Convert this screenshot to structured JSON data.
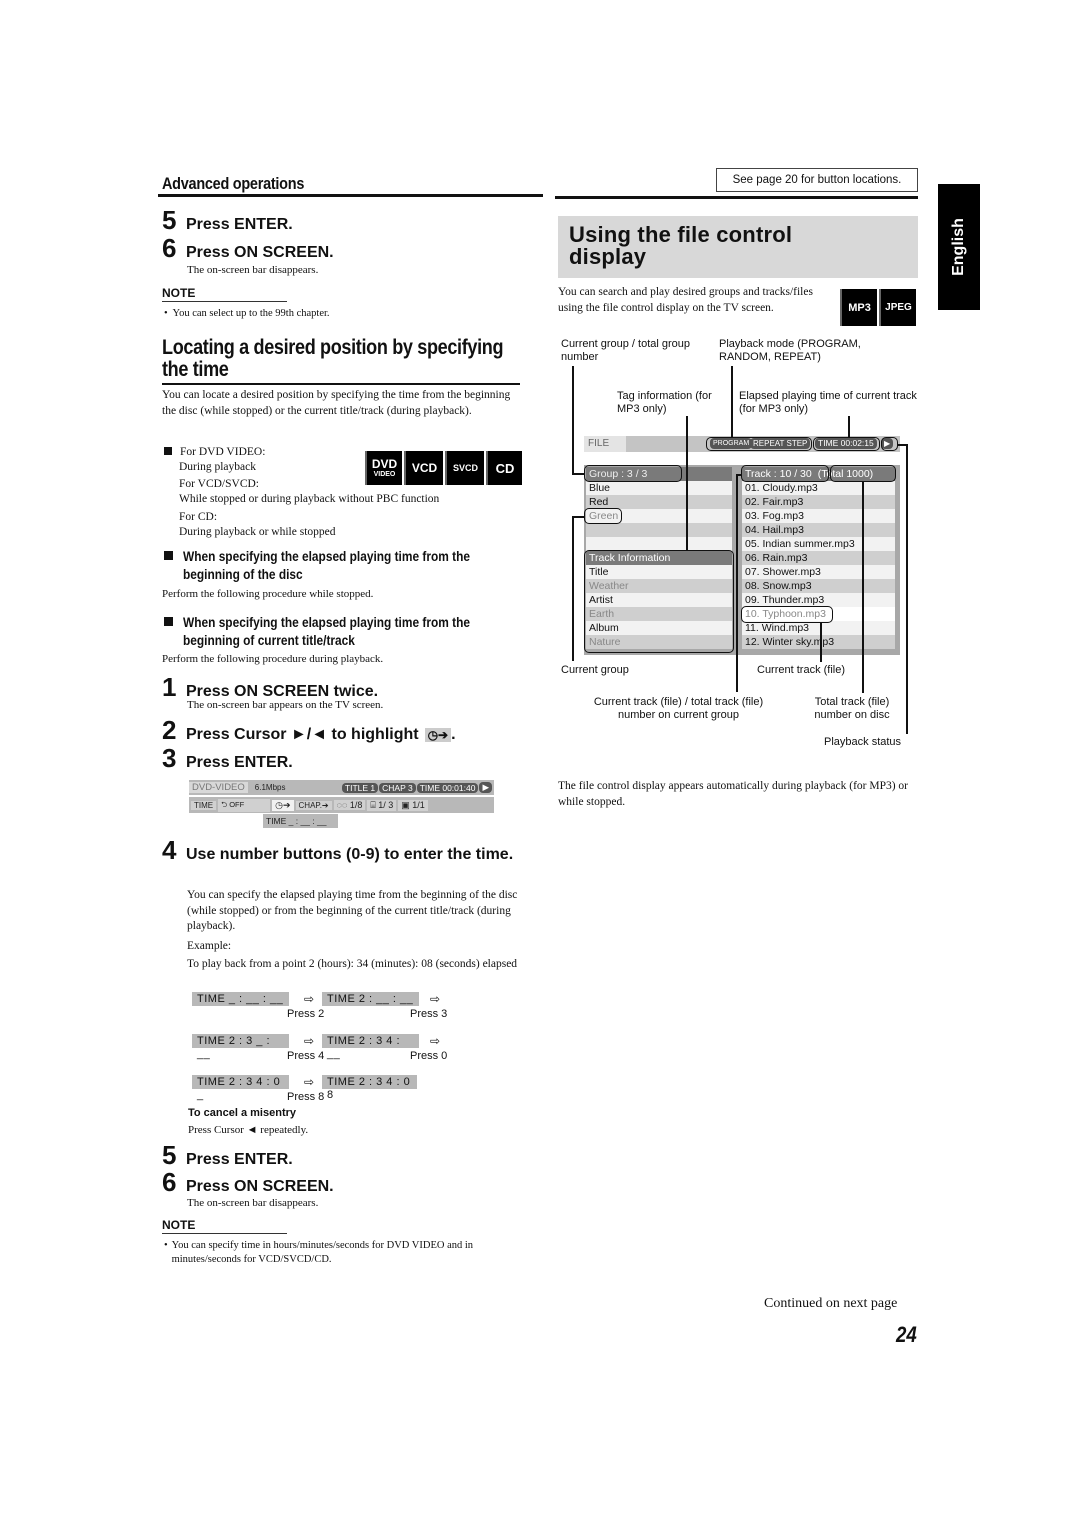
{
  "header": {
    "section_title": "Advanced operations",
    "see_page_note": "See page 20 for button locations.",
    "language_tab": "English"
  },
  "left": {
    "top_steps": [
      {
        "num": "5",
        "label": "Press ENTER."
      },
      {
        "num": "6",
        "label": "Press ON SCREEN."
      }
    ],
    "top_steps_desc": "The on-screen bar disappears.",
    "note1": {
      "label": "NOTE",
      "items": [
        "You can select up to the 99th chapter."
      ]
    },
    "locate_heading": "Locating a desired position by specifying the time",
    "locate_intro": "You can locate a desired position by specifying the time from the beginning the disc (while stopped) or the current title/track (during playback).",
    "conditions": [
      {
        "label": "For DVD VIDEO:",
        "detail": "During playback"
      },
      {
        "label": "For VCD/SVCD:",
        "detail": "While stopped or during playback without PBC function"
      },
      {
        "label": "For CD:",
        "detail": "During playback or while stopped"
      }
    ],
    "disc_badges": [
      {
        "main": "DVD",
        "sub": "VIDEO"
      },
      {
        "main": "VCD",
        "sub": ""
      },
      {
        "main": "SVCD",
        "sub": ""
      },
      {
        "main": "CD",
        "sub": ""
      }
    ],
    "sub_heading_1": "When specifying the elapsed playing time from the beginning of the disc",
    "sub_desc_1": "Perform the following procedure while stopped.",
    "sub_heading_2": "When specifying the elapsed playing time from the beginning of current title/track",
    "sub_desc_2": "Perform the following procedure during playback.",
    "steps": [
      {
        "num": "1",
        "label": "Press ON SCREEN twice.",
        "desc": "The on-screen bar appears on the TV screen."
      },
      {
        "num": "2",
        "label": "Press Cursor ►/◄ to highlight",
        "icon": "◷➔",
        "suffix": "."
      },
      {
        "num": "3",
        "label": "Press ENTER."
      },
      {
        "num": "4",
        "label": "Use number buttons (0-9) to enter the time."
      }
    ],
    "osd_bar": {
      "disc_type": "DVD-VIDEO",
      "bitrate": "6.1Mbps",
      "title": "TITLE  1",
      "chapter": "CHAP  3",
      "time": "TIME 00:01:40",
      "play_status": "▶",
      "row2": [
        "TIME",
        "⮌ OFF",
        "◷➔",
        "CHAP.➔",
        "◌◌ 1/8",
        "⌸ 1/ 3",
        "▣ 1/1"
      ],
      "time_input": "TIME  _ : __ : __"
    },
    "step4_desc": "You can specify the elapsed playing time from the beginning of the disc (while stopped) or from the beginning of the current title/track (during playback).",
    "example_label": "Example:",
    "example_desc": "To play back from a point 2 (hours): 34 (minutes): 08 (seconds) elapsed",
    "time_sequence": [
      {
        "from": "TIME   _ : __ : __",
        "to": "TIME   2 : __ : __",
        "press_a": "Press 2",
        "press_b": "Press 3"
      },
      {
        "from": "TIME   2 : 3 _ : __",
        "to": "TIME   2 : 3 4 : __",
        "press_a": "Press 4",
        "press_b": "Press 0"
      },
      {
        "from": "TIME   2 : 3 4 : 0 _",
        "to": "TIME   2 : 3 4 : 0 8",
        "press_a": "Press 8",
        "press_b": ""
      }
    ],
    "arrow_glyph": "⇨",
    "cancel_heading": "To cancel a misentry",
    "cancel_desc": "Press Cursor ◄ repeatedly.",
    "bottom_steps": [
      {
        "num": "5",
        "label": "Press ENTER."
      },
      {
        "num": "6",
        "label": "Press ON SCREEN."
      }
    ],
    "bottom_steps_desc": "The on-screen bar disappears.",
    "note2": {
      "label": "NOTE",
      "items": [
        "You can specify time in hours/minutes/seconds for DVD VIDEO and in minutes/seconds for VCD/SVCD/CD."
      ]
    }
  },
  "right": {
    "title": "Using the file control display",
    "intro": "You can search and play desired groups and tracks/files using the file control display on the TV screen.",
    "format_badges": [
      "MP3",
      "JPEG"
    ],
    "callouts": {
      "current_group_total": "Current group / total group number",
      "playback_mode": "Playback mode (PROGRAM, RANDOM, REPEAT)",
      "tag_info": "Tag information (for MP3 only)",
      "elapsed_time": "Elapsed playing time of current track (for MP3 only)",
      "current_group": "Current group",
      "current_track": "Current track (file)",
      "track_total_group": "Current track (file) / total track (file) number on current group",
      "total_track_disc": "Total track (file) number on disc",
      "playback_status": "Playback status"
    },
    "file_display": {
      "file_label": "FILE",
      "mode_pills": [
        "PROGRAM",
        "REPEAT STEP"
      ],
      "time": "TIME 00:02:15",
      "status": "▶",
      "group_header": "Group  :   3 / 3",
      "groups": [
        "Blue",
        "Red",
        "Green"
      ],
      "current_group": "Green",
      "track_info_header": "Track  Information",
      "track_info": [
        {
          "label": "Title",
          "value": "Weather"
        },
        {
          "label": "Artist",
          "value": "Earth"
        },
        {
          "label": "Album",
          "value": "Nature"
        }
      ],
      "track_header": "Track  :  10  /  30",
      "total": "(Total   1000)",
      "tracks": [
        "01. Cloudy.mp3",
        "02. Fair.mp3",
        "03. Fog.mp3",
        "04. Hail.mp3",
        "05. Indian summer.mp3",
        "06. Rain.mp3",
        "07. Shower.mp3",
        "08. Snow.mp3",
        "09. Thunder.mp3",
        "10. Typhoon.mp3",
        "11. Wind.mp3",
        "12. Winter sky.mp3"
      ],
      "current_track": "10. Typhoon.mp3"
    },
    "closing_text": "The file control display appears automatically during playback (for MP3) or while stopped."
  },
  "footer": {
    "continued": "Continued on next page",
    "page_number": "24"
  }
}
